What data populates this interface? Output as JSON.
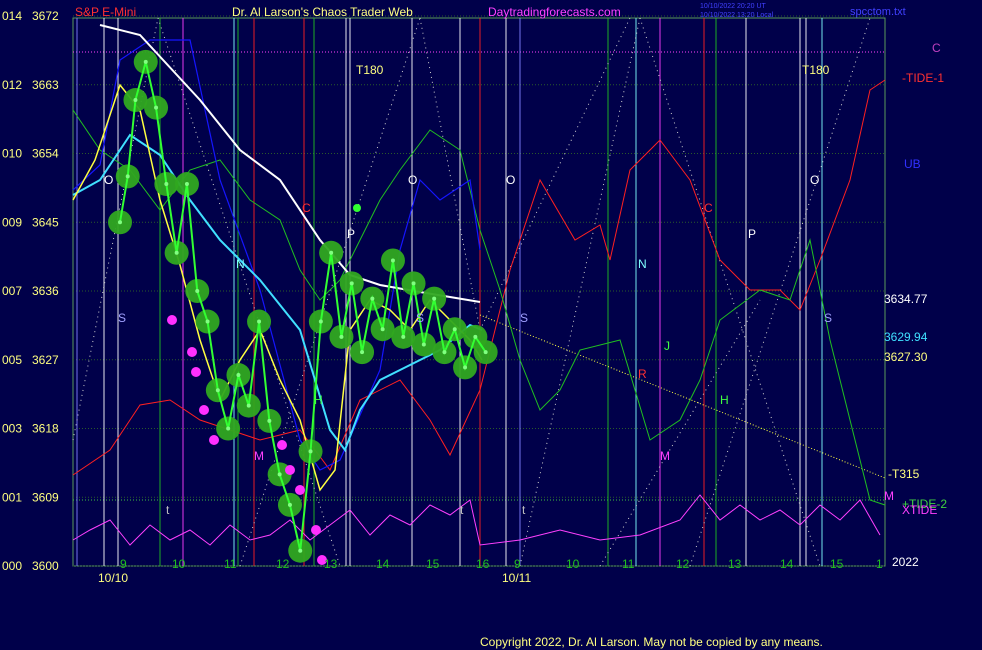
{
  "header": {
    "left_title": "S&P E-Mini",
    "center_title": "Dr. Al Larson's Chaos Trader Web",
    "site": "Daytradingforecasts.com",
    "stamp_1": "10/10/2022 20:20 UT",
    "stamp_2": "10/10/2022 13:20 Local",
    "file": "spcctom.txt"
  },
  "footer": {
    "copyright": "Copyright 2022, Dr. Al Larson. May not be copied by any means."
  },
  "colors": {
    "background": "#00004a",
    "frame": "#5a9a5a",
    "price": "#32ff32",
    "yellow_avg": "#ffff00",
    "cyan_avg": "#40e0ff",
    "white_avg": "#ffffff",
    "tide": "#ff2020",
    "green_line": "#20c020",
    "magenta_osc": "#ff40ff",
    "blue_band": "#1010ff"
  },
  "chart_data": {
    "type": "line",
    "title": "S&P E-Mini",
    "y_axis_left_labels": [
      {
        "code": "014",
        "price": "3672"
      },
      {
        "code": "012",
        "price": "3663"
      },
      {
        "code": "010",
        "price": "3654"
      },
      {
        "code": "009",
        "price": "3645"
      },
      {
        "code": "007",
        "price": "3636"
      },
      {
        "code": "005",
        "price": "3627"
      },
      {
        "code": "003",
        "price": "3618"
      },
      {
        "code": "001",
        "price": "3609"
      },
      {
        "code": "000",
        "price": "3600"
      }
    ],
    "ylim": [
      3600,
      3672
    ],
    "x_hour_labels": [
      "9",
      "10",
      "11",
      "12",
      "13",
      "14",
      "15",
      "16",
      "9",
      "10",
      "11",
      "12",
      "13",
      "14",
      "15",
      "1"
    ],
    "x_date_labels": [
      "10/10",
      "10/11"
    ],
    "right_labels": [
      {
        "text": "C",
        "color": "#c040c0"
      },
      {
        "text": "-TIDE-1",
        "color": "#ff3030"
      },
      {
        "text": "UB",
        "color": "#3030ff"
      },
      {
        "text": "3634.77",
        "color": "#ffffff"
      },
      {
        "text": "3629.94",
        "color": "#40e0ff"
      },
      {
        "text": "3627.30",
        "color": "#ffff80"
      },
      {
        "text": "-T315",
        "color": "#ffff80"
      },
      {
        "text": "+TIDE-2",
        "color": "#40d040"
      },
      {
        "text": "XTIDE",
        "color": "#ff40ff"
      },
      {
        "text": "M",
        "color": "#ff40ff"
      },
      {
        "text": "2022",
        "color": "#ffffff"
      }
    ],
    "chart_annotations": [
      {
        "text": "T180",
        "color": "#ffff80"
      },
      {
        "text": "T180",
        "color": "#ffff80"
      },
      {
        "text": "O",
        "color": "#ffffff"
      },
      {
        "text": "O",
        "color": "#ffffff"
      },
      {
        "text": "O",
        "color": "#ffffff"
      },
      {
        "text": "O",
        "color": "#ffffff"
      },
      {
        "text": "N",
        "color": "#80ffff"
      },
      {
        "text": "N",
        "color": "#80ffff"
      },
      {
        "text": "S",
        "color": "#a0a0ff"
      },
      {
        "text": "S",
        "color": "#a0a0ff"
      },
      {
        "text": "S",
        "color": "#a0a0ff"
      },
      {
        "text": "S",
        "color": "#a0a0ff"
      },
      {
        "text": "C",
        "color": "#ff3030"
      },
      {
        "text": "C",
        "color": "#ff3030"
      },
      {
        "text": "P",
        "color": "#ffffff"
      },
      {
        "text": "P",
        "color": "#ffffff"
      },
      {
        "text": "H",
        "color": "#40ff40"
      },
      {
        "text": "H",
        "color": "#40ff40"
      },
      {
        "text": "M",
        "color": "#ff40ff"
      },
      {
        "text": "M",
        "color": "#ff40ff"
      },
      {
        "text": "J",
        "color": "#40ff40"
      },
      {
        "text": "R",
        "color": "#ff3030"
      },
      {
        "text": "t",
        "color": "#c0c0c0"
      },
      {
        "text": "t",
        "color": "#c0c0c0"
      },
      {
        "text": "t",
        "color": "#c0c0c0"
      }
    ],
    "series": [
      {
        "name": "S&P E-Mini",
        "color": "#32ff32",
        "x": [
          0,
          0.15,
          0.3,
          0.5,
          0.7,
          0.9,
          1.1,
          1.3,
          1.5,
          1.7,
          1.9,
          2.1,
          2.3,
          2.5,
          2.7,
          2.9,
          3.1,
          3.3,
          3.5,
          3.7,
          3.9,
          4.1,
          4.3,
          4.5,
          4.7,
          4.9,
          5.1,
          5.3,
          5.5,
          5.7,
          5.9,
          6.1,
          6.3,
          6.5,
          6.7,
          6.9,
          7.1
        ],
        "y": [
          3645,
          3651,
          3661,
          3666,
          3660,
          3650,
          3641,
          3650,
          3636,
          3632,
          3623,
          3618,
          3625,
          3621,
          3632,
          3619,
          3612,
          3608,
          3602,
          3615,
          3632,
          3641,
          3630,
          3637,
          3628,
          3635,
          3631,
          3640,
          3630,
          3637,
          3629,
          3635,
          3628,
          3631,
          3626,
          3630,
          3628
        ]
      },
      {
        "name": "XTIDE",
        "color": "#ff40ff"
      }
    ]
  }
}
